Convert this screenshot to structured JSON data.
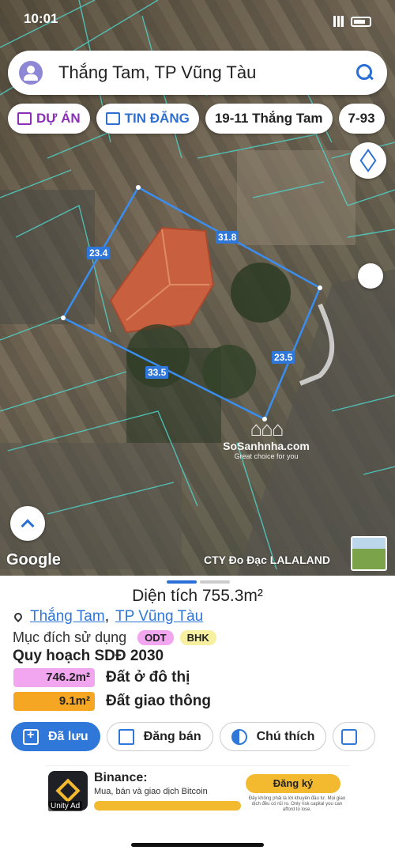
{
  "status": {
    "time": "10:01"
  },
  "search": {
    "query": "Thắng Tam, TP Vũng Tàu"
  },
  "chips": [
    {
      "label": "DỰ ÁN"
    },
    {
      "label": "TIN ĐĂNG"
    },
    {
      "label": "19-11 Thắng Tam"
    },
    {
      "label": "7-93"
    }
  ],
  "map": {
    "dimensions": [
      "31.8",
      "23.4",
      "23.5",
      "33.5"
    ],
    "watermark_brand": "SoSanhnha.com",
    "watermark_tag": "Great choice for you",
    "google": "Google",
    "credit": "CTY Đo Đạc LALALAND"
  },
  "parcel": {
    "area_label": "Diện tích 755.3m²",
    "ward": "Thắng Tam",
    "separator": ",",
    "city": "TP Vũng Tàu",
    "purpose_label": "Mục đích sử dụng",
    "tags": [
      "ODT",
      "BHK"
    ],
    "plan_title": "Quy hoạch SDĐ 2030",
    "plan_rows": [
      {
        "value": "746.2m²",
        "label": "Đất ở đô thị",
        "color": "#f3a6f0"
      },
      {
        "value": "9.1m²",
        "label": "Đất giao thông",
        "color": "#f5a623"
      }
    ]
  },
  "actions": {
    "save": "Đã lưu",
    "post": "Đăng bán",
    "legend": "Chú thích"
  },
  "ad": {
    "title": "Binance:",
    "subtitle": "Mua, bán và giao dịch Bitcoin",
    "cta": "Đăng ký",
    "fine": "Đây không phải là lời khuyên đầu tư. Mọi giao dịch đều có rủi ro. Only risk capital you can afford to lose.",
    "unity": "Unity Ad"
  },
  "colors": {
    "accent": "#2f77d8",
    "parcel_line": "#3a8ef0"
  }
}
